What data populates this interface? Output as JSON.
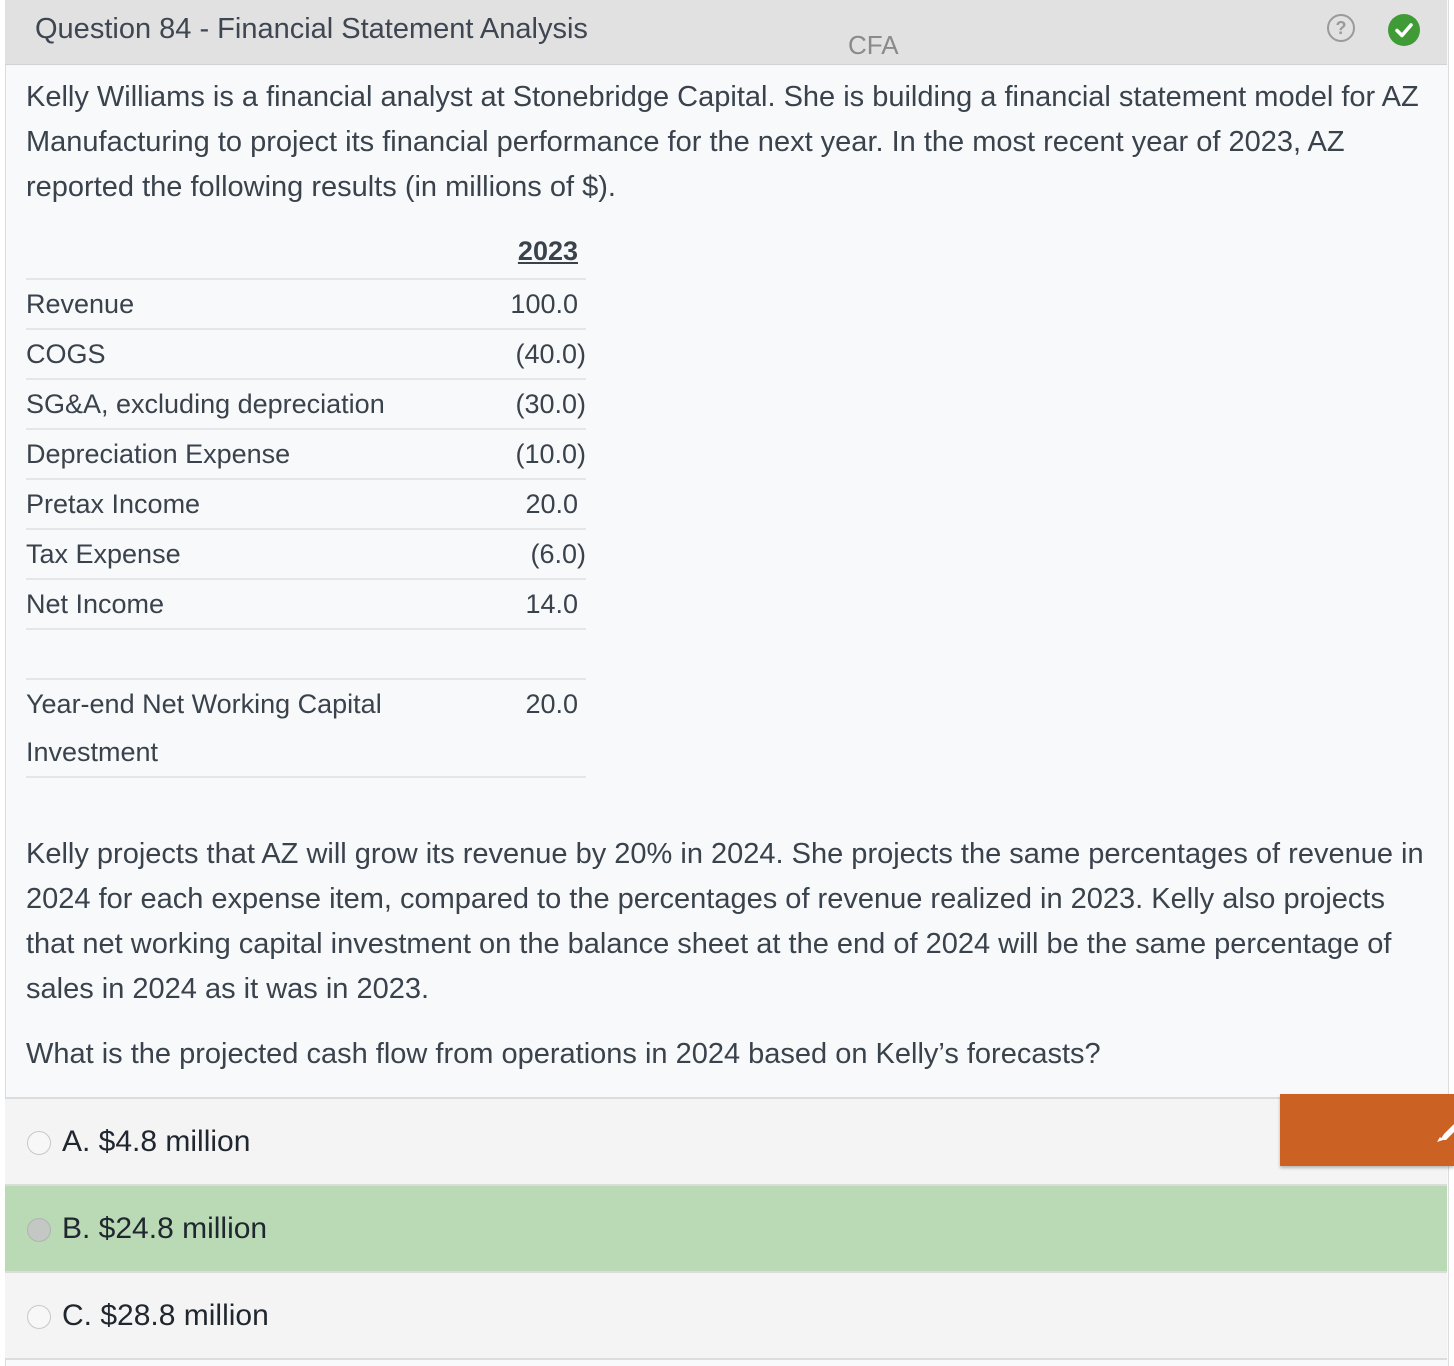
{
  "header": {
    "title": "Question 84 - Financial Statement Analysis",
    "tag": "CFA",
    "help_icon": "?",
    "check_icon": "check-icon"
  },
  "intro": "Kelly Williams is a financial analyst at Stonebridge Capital.  She is building a financial statement model for AZ Manufacturing to project its financial performance for the next year.  In the most recent year of 2023, AZ reported the following results (in millions of $).",
  "table": {
    "year_header": "2023",
    "rows": [
      {
        "label": "Revenue",
        "value": "100.0"
      },
      {
        "label": "COGS",
        "value": "(40.0)"
      },
      {
        "label": "SG&A, excluding depreciation",
        "value": "(30.0)"
      },
      {
        "label": "Depreciation Expense",
        "value": "(10.0)"
      },
      {
        "label": "Pretax Income",
        "value": "20.0"
      },
      {
        "label": "Tax Expense",
        "value": "(6.0)"
      },
      {
        "label": "Net Income",
        "value": "14.0"
      }
    ],
    "nwc": {
      "label": "Year-end Net Working Capital Investment",
      "value": "20.0"
    }
  },
  "projection": "Kelly projects that AZ will grow its revenue by 20% in 2024.  She projects the same percentages of revenue in 2024 for each expense item, compared to the percentages of revenue realized in 2023.  Kelly also projects that net working capital investment on the balance sheet at the end of 2024 will be the same percentage of sales in 2024 as it was in 2023.",
  "question": "What is the projected cash flow from operations in 2024 based on Kelly’s forecasts?",
  "options": [
    {
      "label": "A. $4.8 million",
      "selected": false
    },
    {
      "label": "B. $24.8 million",
      "selected": true
    },
    {
      "label": "C. $28.8 million",
      "selected": false
    }
  ],
  "colors": {
    "accent_orange": "#cb6123",
    "selected_green": "#b9dab5",
    "check_green": "#3f9b35"
  }
}
